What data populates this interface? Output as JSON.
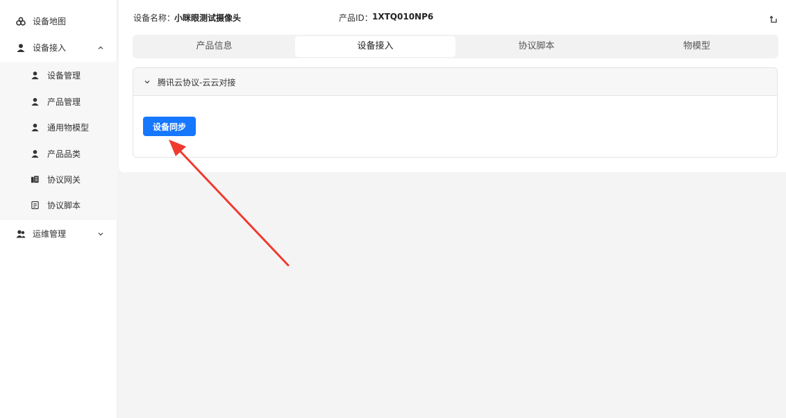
{
  "sidebar": {
    "items": [
      {
        "label": "设备地图",
        "icon": "map-icon"
      },
      {
        "label": "设备接入",
        "icon": "user-icon",
        "expanded": true
      },
      {
        "label": "运维管理",
        "icon": "users-icon",
        "expanded": false
      }
    ],
    "submenu": [
      {
        "label": "设备管理",
        "icon": "user-icon"
      },
      {
        "label": "产品管理",
        "icon": "user-icon"
      },
      {
        "label": "通用物模型",
        "icon": "user-icon"
      },
      {
        "label": "产品品类",
        "icon": "user-icon"
      },
      {
        "label": "协议网关",
        "icon": "gateway-icon"
      },
      {
        "label": "协议脚本",
        "icon": "document-icon"
      }
    ]
  },
  "header": {
    "device_name_label": "设备名称：",
    "device_name": "小眯眼测试摄像头",
    "product_id_label": "产品ID：",
    "product_id": "1XTQ010NP6"
  },
  "tabs": [
    {
      "label": "产品信息",
      "active": false
    },
    {
      "label": "设备接入",
      "active": true
    },
    {
      "label": "协议脚本",
      "active": false
    },
    {
      "label": "物模型",
      "active": false
    }
  ],
  "panel": {
    "title": "腾讯云协议-云云对接",
    "expanded": true,
    "sync_button": "设备同步"
  },
  "colors": {
    "accent": "#1677ff",
    "annotation_arrow": "#f03a2e"
  }
}
